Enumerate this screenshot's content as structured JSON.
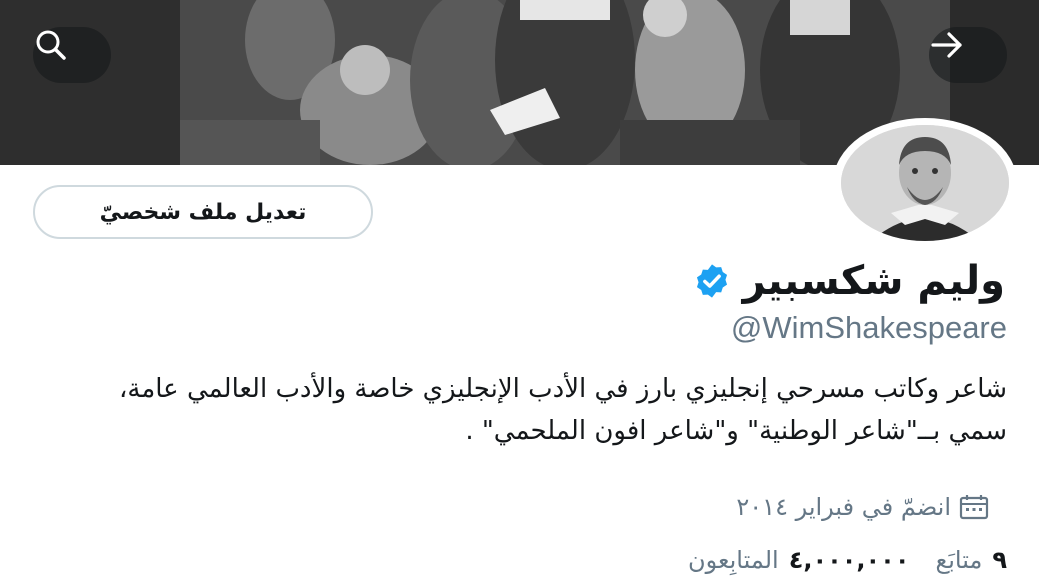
{
  "profile": {
    "display_name": "وليم شكسبير",
    "handle": "@WimShakespeare",
    "bio": "شاعر وكاتب مسرحي إنجليزي بارز في الأدب الإنجليزي خاصة والأدب العالمي عامة، سمي بــ\"شاعر الوطنية\" و\"شاعر افون الملحمي\" .",
    "joined": "انضمّ في فبراير ٢٠١٤",
    "following_count": "٩",
    "following_label": "متابَع",
    "followers_count": "٤,٠٠٠,٠٠٠",
    "followers_label": "المتابِعون",
    "verified": true
  },
  "actions": {
    "edit_profile_label": "تعديل ملف شخصيّ"
  },
  "icons": {
    "search": "search-icon",
    "next": "arrow-right-icon",
    "verified": "verified-badge-icon",
    "calendar": "calendar-icon"
  },
  "colors": {
    "accent": "#1da1f2",
    "secondary_text": "#657786",
    "primary_text": "#14171a",
    "button_border": "#cfd9de"
  }
}
